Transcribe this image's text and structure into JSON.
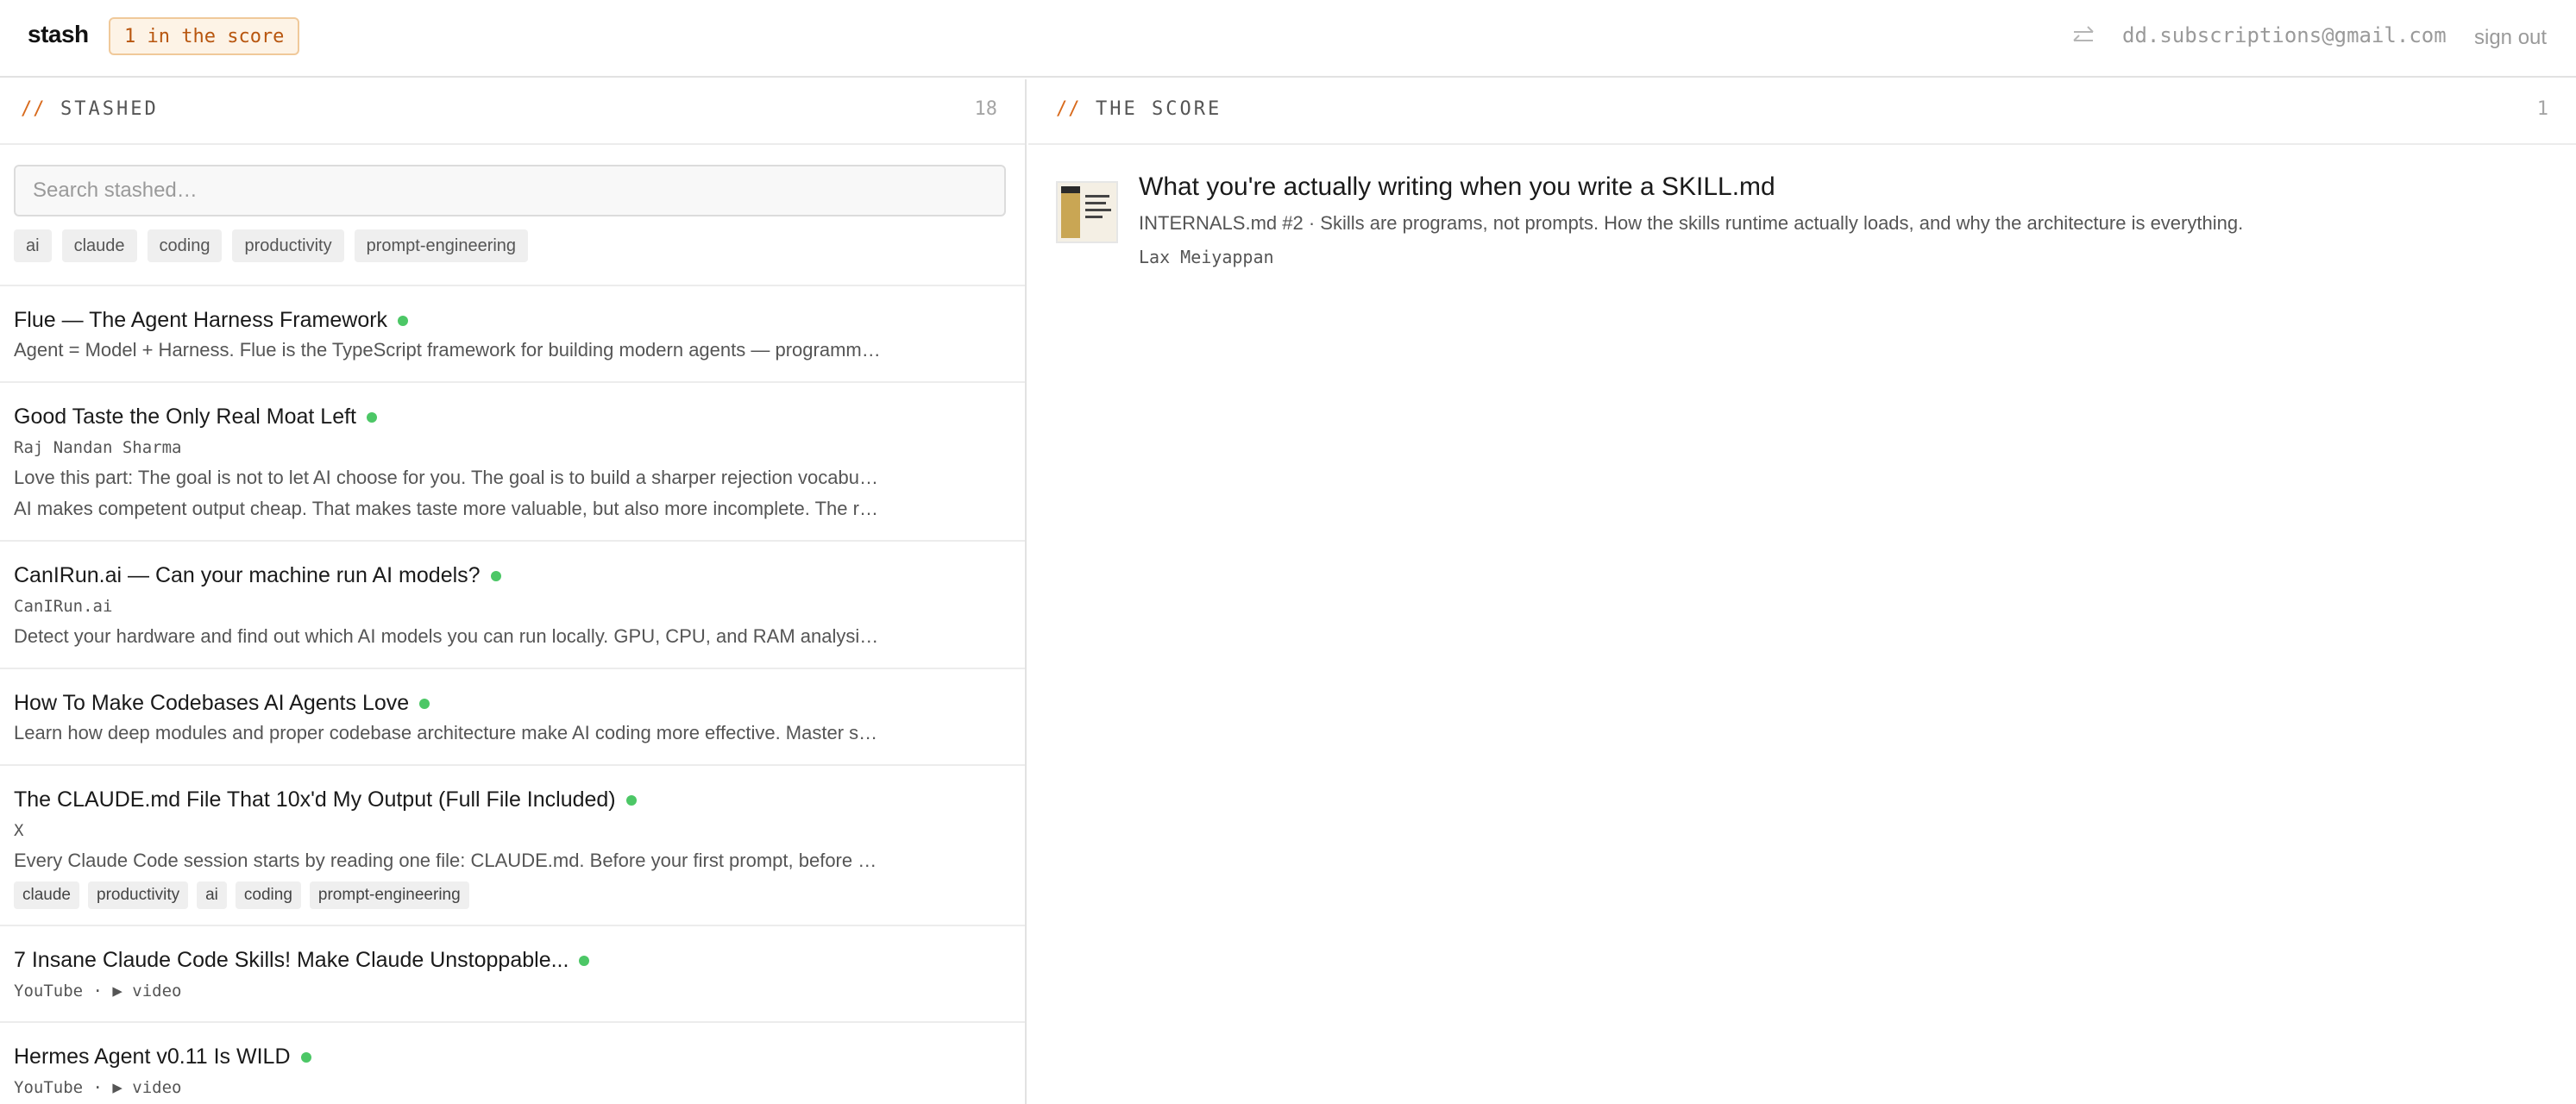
{
  "header": {
    "logo": "stash",
    "score_badge": "1 in the score",
    "swap_icon": "swap-arrows-icon",
    "email": "dd.subscriptions@gmail.com",
    "sign_out": "sign out"
  },
  "stashed": {
    "slashes": "//",
    "title": "STASHED",
    "count": "18",
    "search_placeholder": "Search stashed…",
    "filters": [
      "ai",
      "claude",
      "coding",
      "productivity",
      "prompt-engineering"
    ],
    "items": [
      {
        "title": "Flue — The Agent Harness Framework",
        "status_color": "#4cc766",
        "desc": "Agent = Model + Harness. Flue is the TypeScript framework for building modern agents — programming agents with a harness."
      },
      {
        "title": "Good Taste the Only Real Moat Left",
        "status_color": "#4cc766",
        "source": "Raj Nandan Sharma",
        "note": "Love this part: The goal is not to let AI choose for you. The goal is to build a sharper rejection vocabulary.",
        "desc": "AI makes competent output cheap. That makes taste more valuable, but also more incomplete. The real moat."
      },
      {
        "title": "CanIRun.ai — Can your machine run AI models?",
        "status_color": "#4cc766",
        "source": "CanIRun.ai",
        "desc": "Detect your hardware and find out which AI models you can run locally. GPU, CPU, and RAM analysis for your setup."
      },
      {
        "title": "How To Make Codebases AI Agents Love",
        "status_color": "#4cc766",
        "desc": "Learn how deep modules and proper codebase architecture make AI coding more effective. Master software design."
      },
      {
        "title": "The CLAUDE.md File That 10x'd My Output (Full File Included)",
        "status_color": "#4cc766",
        "source": "X",
        "desc": "Every Claude Code session starts by reading one file: CLAUDE.md. Before your first prompt, before anything else.",
        "tags": [
          "claude",
          "productivity",
          "ai",
          "coding",
          "prompt-engineering"
        ]
      },
      {
        "title": "7 Insane Claude Code Skills! Make Claude Unstoppable...",
        "status_color": "#4cc766",
        "source": "YouTube · ▶ video"
      },
      {
        "title": "Hermes Agent v0.11 Is WILD",
        "status_color": "#4cc766",
        "source": "YouTube · ▶ video"
      }
    ]
  },
  "score": {
    "slashes": "//",
    "title": "THE SCORE",
    "count": "1",
    "card": {
      "title": "What you're actually writing when you write a SKILL.md",
      "desc": "INTERNALS.md #2 · Skills are programs, not prompts. How the skills runtime actually loads, and why the architecture is everything.",
      "author": "Lax Meiyappan"
    }
  }
}
